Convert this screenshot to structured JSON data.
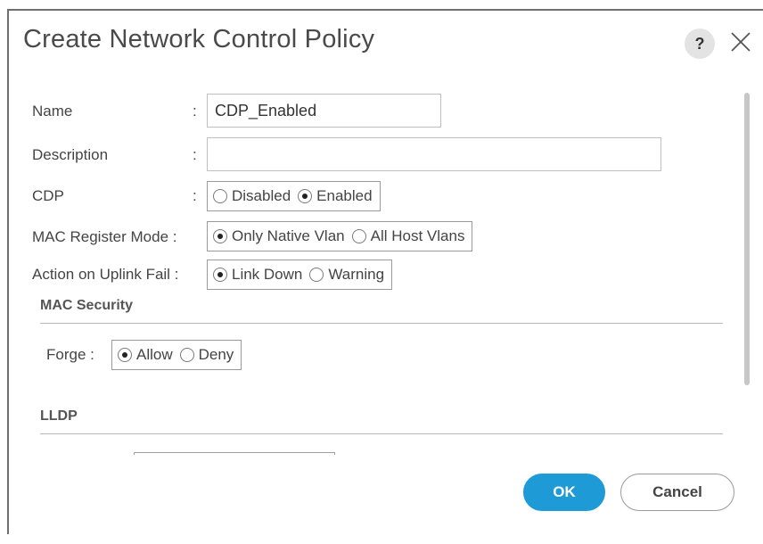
{
  "dialog": {
    "title": "Create Network Control Policy",
    "help_label": "?",
    "close_icon": "close-icon"
  },
  "form": {
    "name": {
      "label": "Name",
      "colon": ":",
      "value": "CDP_Enabled"
    },
    "description": {
      "label": "Description",
      "colon": ":",
      "value": ""
    },
    "cdp": {
      "label": "CDP",
      "colon": ":",
      "options": [
        "Disabled",
        "Enabled"
      ],
      "selected": "Enabled"
    },
    "mac_register_mode": {
      "label": "MAC Register Mode :",
      "options": [
        "Only Native Vlan",
        "All Host Vlans"
      ],
      "selected": "Only Native Vlan"
    },
    "action_on_uplink_fail": {
      "label": "Action on Uplink Fail :",
      "options": [
        "Link Down",
        "Warning"
      ],
      "selected": "Link Down"
    }
  },
  "mac_security": {
    "heading": "MAC Security",
    "forge": {
      "label": "Forge :",
      "options": [
        "Allow",
        "Deny"
      ],
      "selected": "Allow"
    }
  },
  "lldp": {
    "heading": "LLDP"
  },
  "buttons": {
    "ok": "OK",
    "cancel": "Cancel"
  },
  "colors": {
    "accent": "#1e9bd7",
    "title_text": "#4a4a4a"
  }
}
